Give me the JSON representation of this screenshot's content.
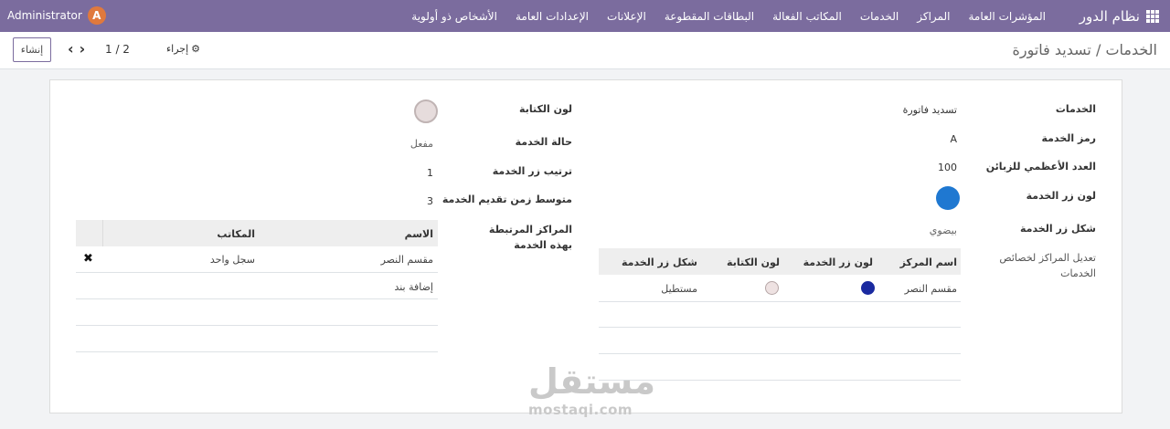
{
  "navbar": {
    "user_name": "Administrator",
    "user_initial": "A",
    "brand": "نظام الدور",
    "menu": [
      "المؤشرات العامة",
      "المراكز",
      "الخدمات",
      "المكاتب الفعالة",
      "البطاقات المقطوعة",
      "الإعلانات",
      "الإعدادات العامة",
      "الأشخاص ذو أولوية"
    ]
  },
  "control": {
    "breadcrumb": "الخدمات / تسديد فاتورة",
    "create_label": "إنشاء",
    "action_label": "إجراء",
    "pager": "1 / 2"
  },
  "form_right": {
    "services_label": "الخدمات",
    "services_value": "تسديد فاتورة",
    "code_label": "رمز الخدمة",
    "code_value": "A",
    "max_customers_label": "العدد الأعظمي للزبائن",
    "max_customers_value": "100",
    "button_color_label": "لون زر الخدمة",
    "button_color": "#1f78d1",
    "button_shape_label": "شكل زر الخدمة",
    "button_shape_value": "بيضوي",
    "edit_centers_label": "تعديل المراكز لخصائص الخدمات"
  },
  "centers_table": {
    "headers": [
      "اسم المركز",
      "لون زر الخدمة",
      "لون الكتابة",
      "شكل زر الخدمة"
    ],
    "rows": [
      {
        "center": "مقسم النصر",
        "button_color": "#1a2aa0",
        "text_color": "#eee2e2",
        "shape": "مستطيل"
      }
    ]
  },
  "form_left": {
    "text_color_label": "لون الكتابة",
    "text_color": "#e6dcdc",
    "status_label": "حالة الخدمة",
    "status_value": "مفعل",
    "order_label": "ترتيب زر الخدمة",
    "order_value": "1",
    "avg_time_label": "متوسط زمن تقديم الخدمة",
    "avg_time_value": "3",
    "linked_centers_label": "المراكز المرتبطة بهذه الخدمة"
  },
  "offices_table": {
    "headers": [
      "الاسم",
      "المكاتب"
    ],
    "rows": [
      {
        "name": "مقسم النصر",
        "offices": "سجل واحد"
      }
    ],
    "add_line": "إضافة بند"
  },
  "watermark": {
    "arabic": "مستقل",
    "latin": "mostaqi.com"
  }
}
